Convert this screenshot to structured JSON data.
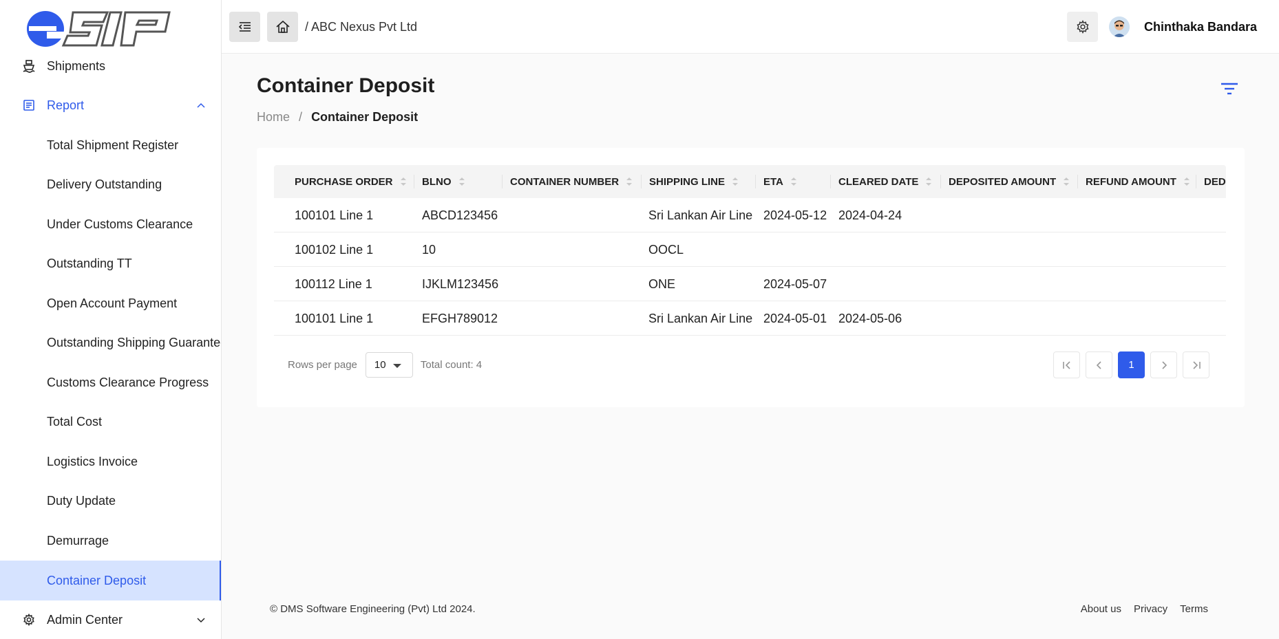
{
  "brand": {
    "logo_text": "eSIP"
  },
  "sidebar": {
    "items": [
      {
        "label": "Shipments"
      },
      {
        "label": "Report"
      },
      {
        "label": "Total Shipment Register"
      },
      {
        "label": "Delivery Outstanding"
      },
      {
        "label": "Under Customs Clearance"
      },
      {
        "label": "Outstanding TT"
      },
      {
        "label": "Open Account Payment"
      },
      {
        "label": "Outstanding Shipping Guarantee"
      },
      {
        "label": "Customs Clearance Progress"
      },
      {
        "label": "Total Cost"
      },
      {
        "label": "Logistics Invoice"
      },
      {
        "label": "Duty Update"
      },
      {
        "label": "Demurrage"
      },
      {
        "label": "Container Deposit"
      },
      {
        "label": "Admin Center"
      }
    ]
  },
  "topbar": {
    "company": "/ ABC Nexus Pvt Ltd",
    "username": "Chinthaka Bandara"
  },
  "page": {
    "title": "Container Deposit",
    "breadcrumb_home": "Home",
    "breadcrumb_sep": "/",
    "breadcrumb_current": "Container Deposit"
  },
  "table": {
    "columns": [
      "PURCHASE ORDER",
      "BLNO",
      "CONTAINER NUMBER",
      "SHIPPING LINE",
      "ETA",
      "CLEARED DATE",
      "DEPOSITED AMOUNT",
      "REFUND AMOUNT",
      "DED"
    ],
    "rows": [
      [
        "100101 Line 1",
        "ABCD123456",
        "",
        "Sri Lankan Air Line",
        "2024-05-12",
        "2024-04-24",
        "",
        "",
        ""
      ],
      [
        "100102 Line 1",
        "10",
        "",
        "OOCL",
        "",
        "",
        "",
        "",
        ""
      ],
      [
        "100112 Line 1",
        "IJKLM123456",
        "",
        "ONE",
        "2024-05-07",
        "",
        "",
        "",
        ""
      ],
      [
        "100101 Line 1",
        "EFGH789012",
        "",
        "Sri Lankan Air Line",
        "2024-05-01",
        "2024-05-06",
        "",
        "",
        ""
      ]
    ]
  },
  "pagination": {
    "rows_per_page_label": "Rows per page",
    "rows_per_page_value": "10",
    "total_label": "Total count: 4",
    "current_page": "1"
  },
  "footer": {
    "copyright": "© DMS Software Engineering (Pvt) Ltd 2024.",
    "links": [
      "About us",
      "Privacy",
      "Terms"
    ]
  },
  "colors": {
    "accent": "#2f5bea",
    "active_bg": "#d6e3ff"
  }
}
